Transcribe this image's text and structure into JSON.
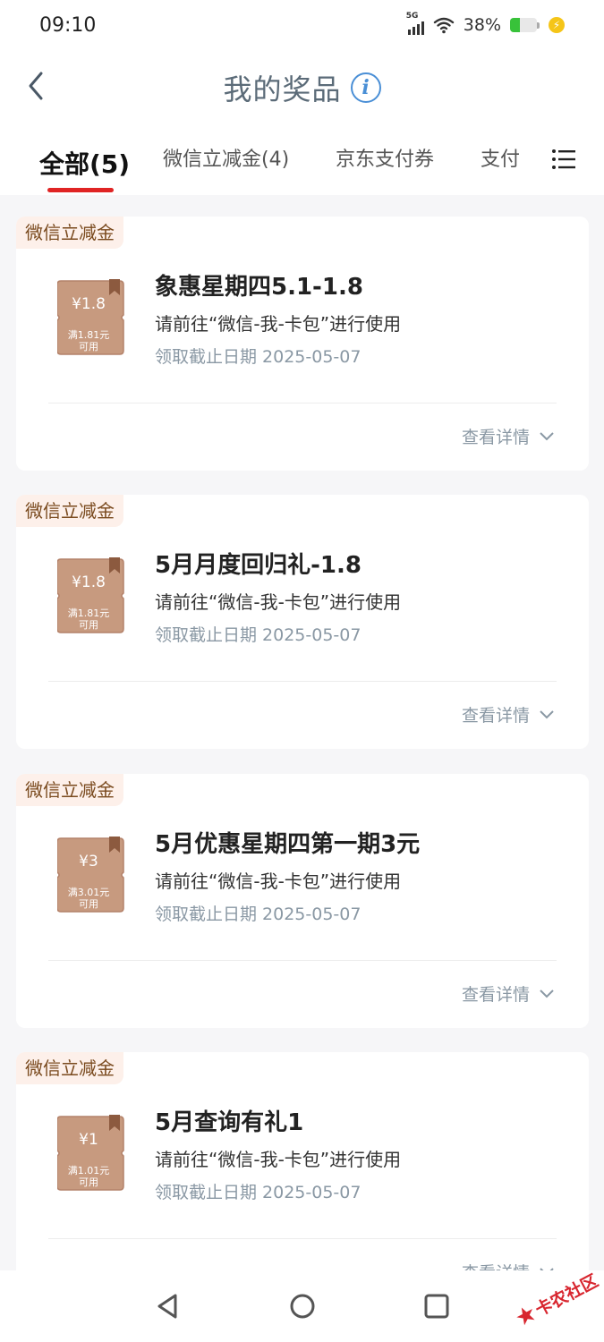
{
  "status_bar": {
    "time": "09:10",
    "network": "5G",
    "battery": "38%",
    "battery_level": 0.38
  },
  "header": {
    "title": "我的奖品",
    "back_icon": "chevron-left-icon",
    "info_icon": "info-icon"
  },
  "tabs": [
    {
      "label": "全部(5)",
      "active": true
    },
    {
      "label": "微信立减金(4)",
      "active": false
    },
    {
      "label": "京东支付券",
      "active": false
    },
    {
      "label": "支付",
      "active": false
    }
  ],
  "tabs_menu_icon": "list-menu-icon",
  "colors": {
    "accent": "#e02424",
    "tag_bg": "#fdf0ea",
    "tag_text": "#7a4a1e",
    "coupon": "#c79a7f",
    "muted": "#8a98a4"
  },
  "prizes": [
    {
      "tag": "微信立减金",
      "coupon_value": "¥1.8",
      "coupon_condition_line1": "满1.81元",
      "coupon_condition_line2": "可用",
      "title": "象惠星期四5.1-1.8",
      "instruction": "请前往“微信-我-卡包”进行使用",
      "deadline": "领取截止日期 2025-05-07",
      "details_label": "查看详情"
    },
    {
      "tag": "微信立减金",
      "coupon_value": "¥1.8",
      "coupon_condition_line1": "满1.81元",
      "coupon_condition_line2": "可用",
      "title": "5月月度回归礼-1.8",
      "instruction": "请前往“微信-我-卡包”进行使用",
      "deadline": "领取截止日期 2025-05-07",
      "details_label": "查看详情"
    },
    {
      "tag": "微信立减金",
      "coupon_value": "¥3",
      "coupon_condition_line1": "满3.01元",
      "coupon_condition_line2": "可用",
      "title": "5月优惠星期四第一期3元",
      "instruction": "请前往“微信-我-卡包”进行使用",
      "deadline": "领取截止日期 2025-05-07",
      "details_label": "查看详情"
    },
    {
      "tag": "微信立减金",
      "coupon_value": "¥1",
      "coupon_condition_line1": "满1.01元",
      "coupon_condition_line2": "可用",
      "title": "5月查询有礼1",
      "instruction": "请前往“微信-我-卡包”进行使用",
      "deadline": "领取截止日期 2025-05-07",
      "details_label": "查看详情"
    }
  ],
  "system_nav": {
    "back": "triangle-back-icon",
    "home": "circle-home-icon",
    "recents": "square-recents-icon"
  },
  "watermark": {
    "text": "卡农社区"
  }
}
